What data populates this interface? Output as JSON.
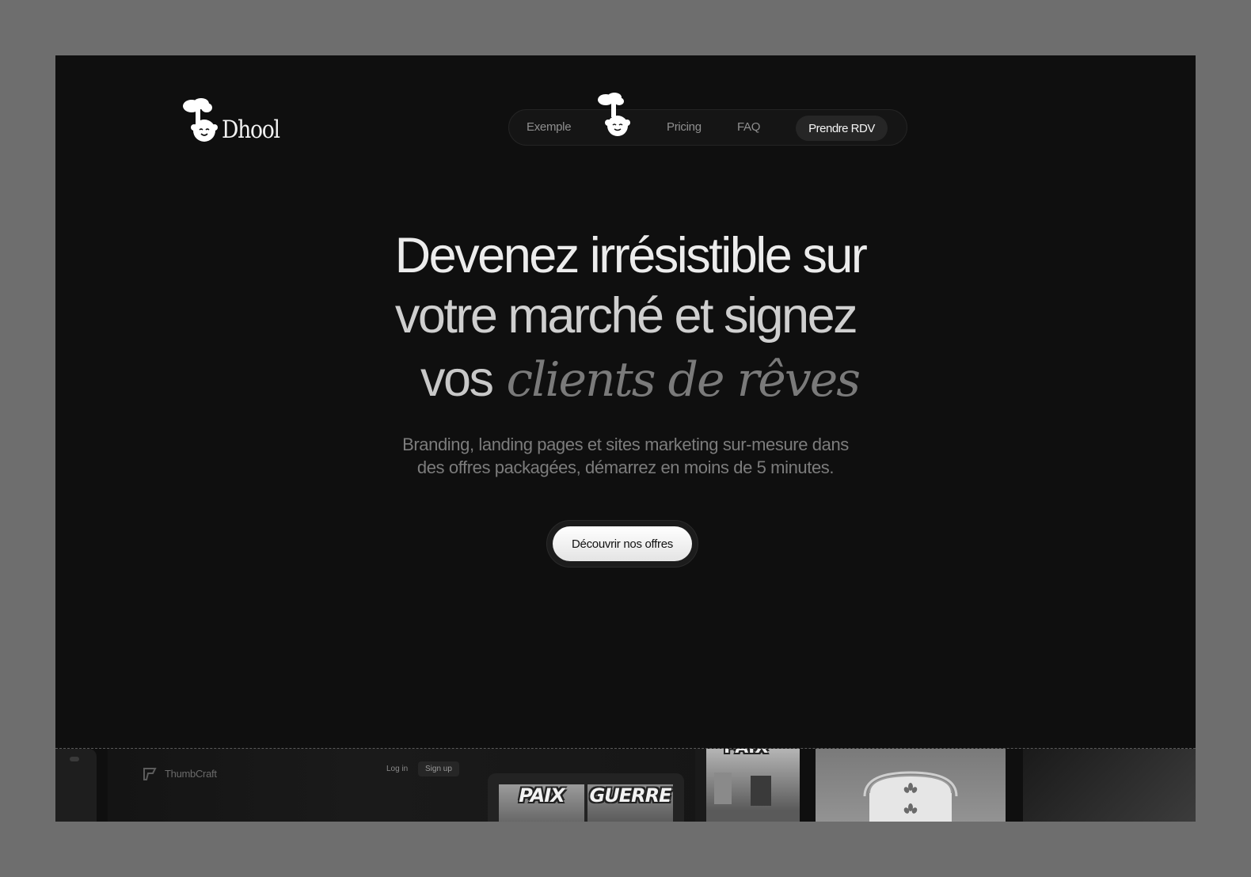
{
  "brand": {
    "name": "Dhool"
  },
  "nav": {
    "links": [
      {
        "label": "Exemple"
      },
      {
        "label": "Pricing"
      },
      {
        "label": "FAQ"
      }
    ],
    "cta_label": "Prendre RDV"
  },
  "hero": {
    "line1": "Devenez irrésistible sur",
    "line2": "votre marché et signez",
    "line3_plain": "vos",
    "line3_italic": "clients de rêves",
    "subtitle": "Branding, landing pages et sites marketing sur-mesure dans des offres packagées, démarrez en moins de 5 minutes.",
    "cta_label": "Découvrir nos offres"
  },
  "showcase": {
    "thumbcraft": {
      "name": "ThumbCraft",
      "login_label": "Log in",
      "signup_label": "Sign up",
      "thumbnail_left": "PAIX",
      "thumbnail_right": "GUERRE"
    },
    "game_card_text": "PAIX"
  },
  "icons": [
    "chef-mascot-icon",
    "thumbcraft-logo-icon",
    "wheat-icon"
  ],
  "colors": {
    "background": "#0f0f0f",
    "outer": "#6e6e6e",
    "cta_bg": "#ffffff",
    "nav_cta_bg": "#262626"
  }
}
